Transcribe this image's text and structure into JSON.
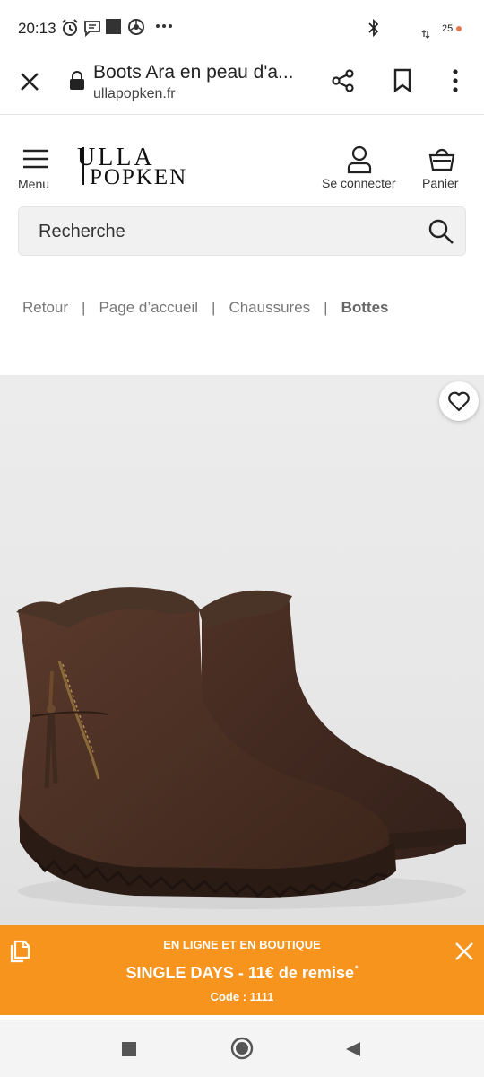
{
  "status_bar": {
    "time": "20:13",
    "battery": "25",
    "icons": [
      "alarm-icon",
      "message-icon",
      "app-square-icon",
      "chrome-icon",
      "more-dots-icon",
      "bluetooth-icon",
      "data-arrows-icon"
    ]
  },
  "browser": {
    "title": "Boots Ara en peau d'a...",
    "url": "ullapopken.fr",
    "icons": [
      "close-icon",
      "lock-icon",
      "share-icon",
      "bookmark-icon",
      "overflow-menu-icon"
    ]
  },
  "header": {
    "menu_label": "Menu",
    "logo_line1": "ULLA",
    "logo_line2": "POPKEN",
    "login_label": "Se connecter",
    "cart_label": "Panier"
  },
  "search": {
    "placeholder": "Recherche"
  },
  "breadcrumb": {
    "items": [
      "Retour",
      "Page d’accueil",
      "Chaussures",
      "Bottes"
    ],
    "separator": "|"
  },
  "product": {
    "image_icon": "brown-suede-boots-image",
    "wishlist_icon": "heart-icon"
  },
  "promo": {
    "line1": "EN LIGNE ET EN BOUTIQUE",
    "line2": "SINGLE DAYS - 11€ de remise",
    "star": "*",
    "line3": "Code : 1111",
    "color": "#f7941d"
  },
  "nav": {
    "icons": [
      "recents-square-icon",
      "home-circle-icon",
      "back-triangle-icon"
    ]
  }
}
